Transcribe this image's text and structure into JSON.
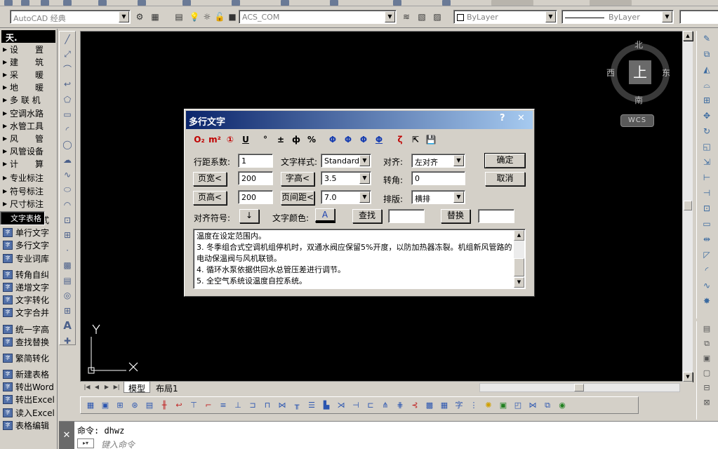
{
  "topbar": {
    "workspace": "AutoCAD 经典",
    "layer": "ACS_COM",
    "color": "ByLayer",
    "linetype": "ByLayer"
  },
  "left_menu": {
    "header": "天.",
    "items": [
      "设　　置",
      "建　　筑",
      "采　　暖",
      "地　　暖",
      "多 联 机",
      "空调水路",
      "水管工具",
      "风　　管",
      "风管设备",
      "计　　算",
      "专业标注",
      "符号标注",
      "尺寸标注",
      "文字表格"
    ],
    "tools": [
      "文字样式",
      "单行文字",
      "多行文字",
      "专业词库",
      "转角自纠",
      "递增文字",
      "文字转化",
      "文字合并",
      "统一字高",
      "查找替换",
      "繁简转化",
      "新建表格",
      "转出Word",
      "转出Excel",
      "读入Excel",
      "表格编辑"
    ]
  },
  "compass": {
    "north": "北",
    "south": "南",
    "east": "东",
    "west": "西",
    "face": "上",
    "wcs": "WCS"
  },
  "ucs": {
    "x": "X",
    "y": "Y"
  },
  "tabs": {
    "model": "模型",
    "layout1": "布局1"
  },
  "dialog": {
    "title": "多行文字",
    "help": "?",
    "close": "✕",
    "format_buttons": [
      "O₂",
      "m²",
      "①",
      "U",
      "°",
      "±",
      "ф",
      "%",
      "Φ",
      "Φ",
      "Φ",
      "Φ",
      "ζ",
      "⇱",
      "💾"
    ],
    "line_spacing_label": "行距系数:",
    "line_spacing_value": "1",
    "text_style_label": "文字样式:",
    "text_style_value": "Standard",
    "align_label": "对齐:",
    "align_value": "左对齐",
    "ok": "确定",
    "page_width_btn": "页宽<",
    "page_width_value": "200",
    "char_height_btn": "字高<",
    "char_height_value": "3.5",
    "rotate_label": "转角:",
    "rotate_value": "0",
    "cancel": "取消",
    "page_height_btn": "页高<",
    "page_height_value": "200",
    "page_gap_btn": "页间距<",
    "page_gap_value": "7.0",
    "layout_label": "排版:",
    "layout_value": "横排",
    "align_symbol_label": "对齐符号:",
    "align_symbol_btn": "↓",
    "text_color_label": "文字颜色:",
    "text_color_btn": "A",
    "find_btn": "查找",
    "find_value": "",
    "replace_btn": "替换",
    "replace_value": "",
    "content": "温度在设定范围内。\n3. 冬季组合式空调机组停机时，双通水阀应保留5%开度，以防加热器冻裂。机组新风管路的电动保温阀与风机联锁。\n4. 循环水泵依据供回水总管压差进行调节。\n5. 全空气系统设温度自控系统。"
  },
  "command": {
    "prompt_line": "命令: dhwz",
    "input_placeholder": "键入命令"
  }
}
